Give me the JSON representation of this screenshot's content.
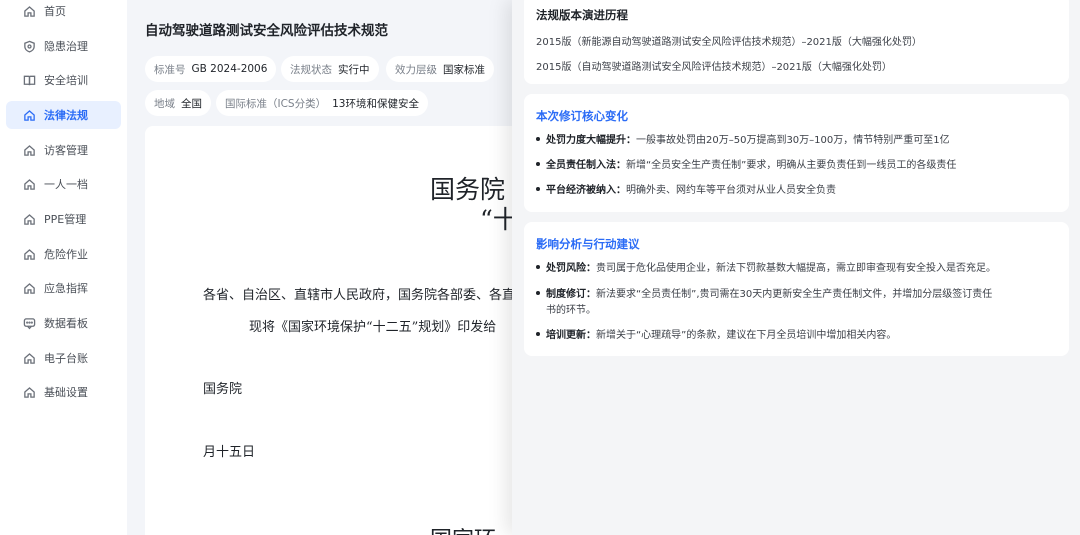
{
  "sidebar": {
    "items": [
      {
        "label": "首页",
        "icon": "home-icon"
      },
      {
        "label": "隐患治理",
        "icon": "shield-icon"
      },
      {
        "label": "安全培训",
        "icon": "book-icon"
      },
      {
        "label": "法律法规",
        "icon": "home-icon",
        "active": true
      },
      {
        "label": "访客管理",
        "icon": "home-icon"
      },
      {
        "label": "一人一档",
        "icon": "home-icon"
      },
      {
        "label": "PPE管理",
        "icon": "home-icon"
      },
      {
        "label": "危险作业",
        "icon": "home-icon"
      },
      {
        "label": "应急指挥",
        "icon": "home-icon"
      },
      {
        "label": "数据看板",
        "icon": "chat-icon"
      },
      {
        "label": "电子台账",
        "icon": "home-icon"
      },
      {
        "label": "基础设置",
        "icon": "home-icon"
      }
    ]
  },
  "main": {
    "title": "自动驾驶道路测试安全风险评估技术规范",
    "tags": [
      {
        "key": "标准号",
        "value": "GB 2024-2006"
      },
      {
        "key": "法规状态",
        "value": "实行中"
      },
      {
        "key": "效力层级",
        "value": "国家标准"
      },
      {
        "key": "地域",
        "value": "全国"
      },
      {
        "key": "国际标准（ICS分类）",
        "value": "13环境和保健安全"
      }
    ],
    "document": {
      "heading_1": "国务院",
      "heading_2": "“十",
      "para_1": "各省、自治区、直辖市人民政府，国务院各部委、各直",
      "para_2": "现将《国家环境保护“十二五”规划》印发给",
      "signer": "国务院",
      "date": "月十五日",
      "bottom": "国家环"
    }
  },
  "drawer": {
    "history": {
      "title": "法规版本演进历程",
      "lines": [
        "2015版（新能源自动驾驶道路测试安全风险评估技术规范）–2021版（大幅强化处罚）",
        "2015版（自动驾驶道路测试安全风险评估技术规范）–2021版（大幅强化处罚）"
      ]
    },
    "changes": {
      "title": "本次修订核心变化",
      "items": [
        {
          "label": "处罚力度大幅提升：",
          "text": "一般事故处罚由20万–50万提高到30万–100万，情节特别严重可至1亿"
        },
        {
          "label": "全员责任制入法：",
          "text": "新增“全员安全生产责任制”要求，明确从主要负责任到一线员工的各级责任"
        },
        {
          "label": "平台经济被纳入：",
          "text": "明确外卖、网约车等平台须对从业人员安全负责"
        }
      ]
    },
    "impact": {
      "title": "影响分析与行动建议",
      "items": [
        {
          "label": "处罚风险：",
          "text": "贵司属于危化品使用企业，新法下罚款基数大幅提高，需立即审查现有安全投入是否充足。"
        },
        {
          "label": "制度修订：",
          "text": "新法要求“全员责任制”,贵司需在30天内更新安全生产责任制文件，并增加分层级签订责任",
          "cont": "书的环节。"
        },
        {
          "label": "培训更新：",
          "text": "新增关于“心理疏导”的条款，建议在下月全员培训中增加相关内容。"
        }
      ]
    }
  }
}
